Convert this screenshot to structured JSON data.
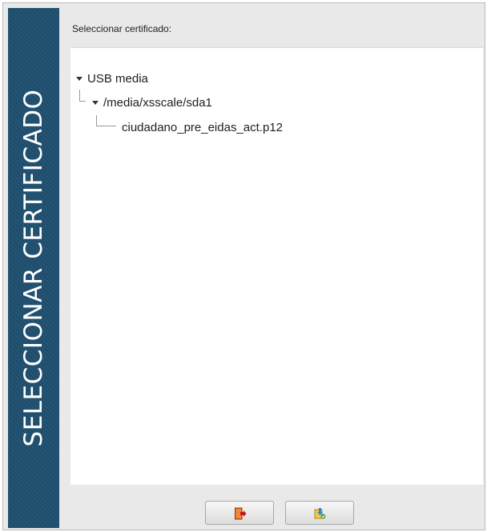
{
  "sidebar": {
    "title": "SELECCIONAR CERTIFICADO",
    "color": "#1f4f6f"
  },
  "prompt": {
    "label": "Seleccionar certificado:"
  },
  "tree": {
    "root": {
      "label": "USB media",
      "expanded": true
    },
    "folder": {
      "label": "/media/xsscale/sda1",
      "expanded": true
    },
    "file": {
      "label": "ciudadano_pre_eidas_act.p12"
    }
  },
  "buttons": {
    "exit": {
      "icon": "exit-door-icon"
    },
    "select": {
      "icon": "certificate-select-icon"
    }
  }
}
